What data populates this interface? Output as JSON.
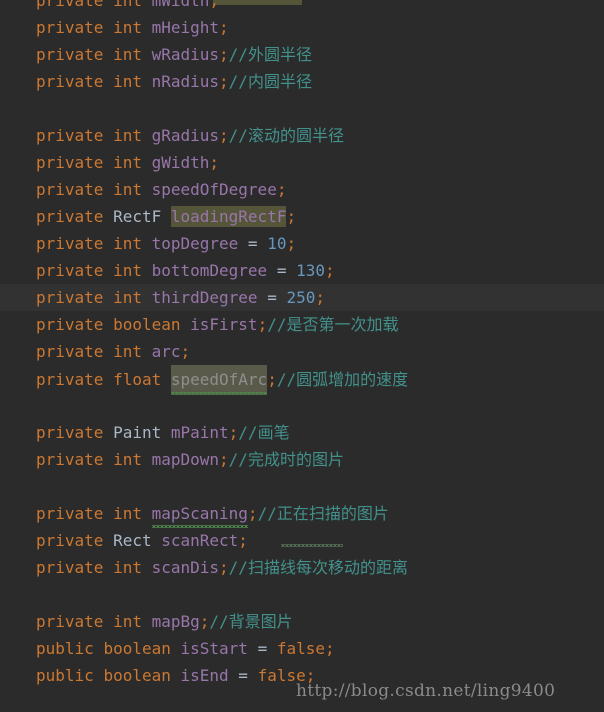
{
  "editor": {
    "theme": "darcula",
    "background_color": "#2b2b2b",
    "current_line_color": "#323232",
    "colors": {
      "keyword": "#cc7832",
      "type": "#a9b7c6",
      "field": "#9876aa",
      "number": "#6897bb",
      "comment": "#42918b",
      "highlight": "#55553a",
      "squiggle": "#4f8a4f",
      "watermark": "#8a8a8a"
    }
  },
  "watermark": {
    "text": "http://blog.csdn.net/ling9400"
  },
  "lines": [
    {
      "id": "line-mwidth",
      "blank": false,
      "current": false,
      "tokens": [
        {
          "cls": "kw",
          "text": "private "
        },
        {
          "cls": "kw",
          "text": "int "
        },
        {
          "cls": "field",
          "text": "mWidth"
        },
        {
          "cls": "punc",
          "text": ";"
        }
      ]
    },
    {
      "id": "line-mheight",
      "blank": false,
      "current": false,
      "tokens": [
        {
          "cls": "kw",
          "text": "private "
        },
        {
          "cls": "kw",
          "text": "int "
        },
        {
          "cls": "field",
          "text": "mHeight"
        },
        {
          "cls": "punc",
          "text": ";"
        }
      ]
    },
    {
      "id": "line-wradius",
      "blank": false,
      "current": false,
      "tokens": [
        {
          "cls": "kw",
          "text": "private "
        },
        {
          "cls": "kw",
          "text": "int "
        },
        {
          "cls": "field",
          "text": "wRadius"
        },
        {
          "cls": "punc",
          "text": ";"
        },
        {
          "cls": "cmt",
          "text": "//外圆半径"
        }
      ]
    },
    {
      "id": "line-nradius",
      "blank": false,
      "current": false,
      "tokens": [
        {
          "cls": "kw",
          "text": "private "
        },
        {
          "cls": "kw",
          "text": "int "
        },
        {
          "cls": "field",
          "text": "nRadius"
        },
        {
          "cls": "punc",
          "text": ";"
        },
        {
          "cls": "cmt",
          "text": "//内圆半径"
        }
      ]
    },
    {
      "id": "line-blank-1",
      "blank": true,
      "current": false,
      "tokens": []
    },
    {
      "id": "line-gradius",
      "blank": false,
      "current": false,
      "tokens": [
        {
          "cls": "kw",
          "text": "private "
        },
        {
          "cls": "kw",
          "text": "int "
        },
        {
          "cls": "field",
          "text": "gRadius"
        },
        {
          "cls": "punc",
          "text": ";"
        },
        {
          "cls": "cmt",
          "text": "//滚动的圆半径"
        }
      ]
    },
    {
      "id": "line-gwidth",
      "blank": false,
      "current": false,
      "tokens": [
        {
          "cls": "kw",
          "text": "private "
        },
        {
          "cls": "kw",
          "text": "int "
        },
        {
          "cls": "field",
          "text": "gWidth"
        },
        {
          "cls": "punc",
          "text": ";"
        }
      ]
    },
    {
      "id": "line-speedofdegree",
      "blank": false,
      "current": false,
      "tokens": [
        {
          "cls": "kw",
          "text": "private "
        },
        {
          "cls": "kw",
          "text": "int "
        },
        {
          "cls": "field",
          "text": "speedOfDegree"
        },
        {
          "cls": "punc",
          "text": ";"
        }
      ]
    },
    {
      "id": "line-loadingrectf",
      "blank": false,
      "current": false,
      "tokens": [
        {
          "cls": "kw",
          "text": "private "
        },
        {
          "cls": "type",
          "text": "RectF "
        },
        {
          "cls": "hl",
          "text": "loadingRectF"
        },
        {
          "cls": "punc",
          "text": ";"
        }
      ]
    },
    {
      "id": "line-topdegree",
      "blank": false,
      "current": false,
      "tokens": [
        {
          "cls": "kw",
          "text": "private "
        },
        {
          "cls": "kw",
          "text": "int "
        },
        {
          "cls": "field",
          "text": "topDegree "
        },
        {
          "cls": "plain",
          "text": "= "
        },
        {
          "cls": "num",
          "text": "10"
        },
        {
          "cls": "punc",
          "text": ";"
        }
      ]
    },
    {
      "id": "line-bottomdegree",
      "blank": false,
      "current": false,
      "tokens": [
        {
          "cls": "kw",
          "text": "private "
        },
        {
          "cls": "kw",
          "text": "int "
        },
        {
          "cls": "field",
          "text": "bottomDegree "
        },
        {
          "cls": "plain",
          "text": "= "
        },
        {
          "cls": "num",
          "text": "130"
        },
        {
          "cls": "punc",
          "text": ";"
        }
      ]
    },
    {
      "id": "line-thirddegree",
      "blank": false,
      "current": true,
      "tokens": [
        {
          "cls": "kw",
          "text": "private "
        },
        {
          "cls": "kw",
          "text": "int "
        },
        {
          "cls": "field",
          "text": "thirdDegree "
        },
        {
          "cls": "plain",
          "text": "= "
        },
        {
          "cls": "num",
          "text": "250"
        },
        {
          "cls": "punc",
          "text": ";"
        }
      ]
    },
    {
      "id": "line-isfirst",
      "blank": false,
      "current": false,
      "tokens": [
        {
          "cls": "kw",
          "text": "private "
        },
        {
          "cls": "kw",
          "text": "boolean "
        },
        {
          "cls": "field",
          "text": "isFirst"
        },
        {
          "cls": "punc",
          "text": ";"
        },
        {
          "cls": "cmt",
          "text": "//是否第一次加载"
        }
      ]
    },
    {
      "id": "line-arc",
      "blank": false,
      "current": false,
      "tokens": [
        {
          "cls": "kw",
          "text": "private "
        },
        {
          "cls": "kw",
          "text": "int "
        },
        {
          "cls": "field",
          "text": "arc"
        },
        {
          "cls": "punc",
          "text": ";"
        }
      ]
    },
    {
      "id": "line-speedofarc",
      "blank": false,
      "current": false,
      "tokens": [
        {
          "cls": "kw",
          "text": "private "
        },
        {
          "cls": "kw",
          "text": "float "
        },
        {
          "cls": "hl2",
          "text": "speedOfArc",
          "squiggle": true
        },
        {
          "cls": "punc",
          "text": ";"
        },
        {
          "cls": "cmt",
          "text": "//圆弧增加的速度"
        }
      ]
    },
    {
      "id": "line-blank-2",
      "blank": true,
      "current": false,
      "tokens": []
    },
    {
      "id": "line-mpaint",
      "blank": false,
      "current": false,
      "tokens": [
        {
          "cls": "kw",
          "text": "private "
        },
        {
          "cls": "type",
          "text": "Paint "
        },
        {
          "cls": "field",
          "text": "mPaint"
        },
        {
          "cls": "punc",
          "text": ";"
        },
        {
          "cls": "cmt",
          "text": "//画笔"
        }
      ]
    },
    {
      "id": "line-mapdown",
      "blank": false,
      "current": false,
      "tokens": [
        {
          "cls": "kw",
          "text": "private "
        },
        {
          "cls": "kw",
          "text": "int "
        },
        {
          "cls": "field",
          "text": "mapDown"
        },
        {
          "cls": "punc",
          "text": ";"
        },
        {
          "cls": "cmt",
          "text": "//完成时的图片"
        }
      ]
    },
    {
      "id": "line-blank-3",
      "blank": true,
      "current": false,
      "tokens": []
    },
    {
      "id": "line-mapscaning",
      "blank": false,
      "current": false,
      "tokens": [
        {
          "cls": "kw",
          "text": "private "
        },
        {
          "cls": "kw",
          "text": "int "
        },
        {
          "cls": "field",
          "text": "mapScaning",
          "squiggle": true
        },
        {
          "cls": "punc",
          "text": ";"
        },
        {
          "cls": "cmt",
          "text": "//正在扫描的图片"
        }
      ]
    },
    {
      "id": "line-scanrect",
      "blank": false,
      "current": false,
      "tokens": [
        {
          "cls": "kw",
          "text": "private "
        },
        {
          "cls": "type",
          "text": "Rect "
        },
        {
          "cls": "field",
          "text": "scanRect"
        },
        {
          "cls": "punc",
          "text": ";"
        }
      ]
    },
    {
      "id": "line-scandis",
      "blank": false,
      "current": false,
      "tokens": [
        {
          "cls": "kw",
          "text": "private "
        },
        {
          "cls": "kw",
          "text": "int "
        },
        {
          "cls": "field",
          "text": "scanDis"
        },
        {
          "cls": "punc",
          "text": ";"
        },
        {
          "cls": "cmt",
          "text": "//扫描线每次移动的距离"
        }
      ]
    },
    {
      "id": "line-blank-4",
      "blank": true,
      "current": false,
      "tokens": []
    },
    {
      "id": "line-mapbg",
      "blank": false,
      "current": false,
      "tokens": [
        {
          "cls": "kw",
          "text": "private "
        },
        {
          "cls": "kw",
          "text": "int "
        },
        {
          "cls": "field",
          "text": "mapBg"
        },
        {
          "cls": "punc",
          "text": ";"
        },
        {
          "cls": "cmt",
          "text": "//背景图片"
        }
      ]
    },
    {
      "id": "line-isstart",
      "blank": false,
      "current": false,
      "tokens": [
        {
          "cls": "kw",
          "text": "public "
        },
        {
          "cls": "kw",
          "text": "boolean "
        },
        {
          "cls": "field",
          "text": "isStart "
        },
        {
          "cls": "plain",
          "text": "= "
        },
        {
          "cls": "kw",
          "text": "false"
        },
        {
          "cls": "punc",
          "text": ";"
        }
      ]
    },
    {
      "id": "line-isend",
      "blank": false,
      "current": false,
      "tokens": [
        {
          "cls": "kw",
          "text": "public "
        },
        {
          "cls": "kw",
          "text": "boolean "
        },
        {
          "cls": "field",
          "text": "isEnd "
        },
        {
          "cls": "plain",
          "text": "= "
        },
        {
          "cls": "kw",
          "text": "false"
        },
        {
          "cls": "punc",
          "text": ";"
        }
      ]
    }
  ]
}
